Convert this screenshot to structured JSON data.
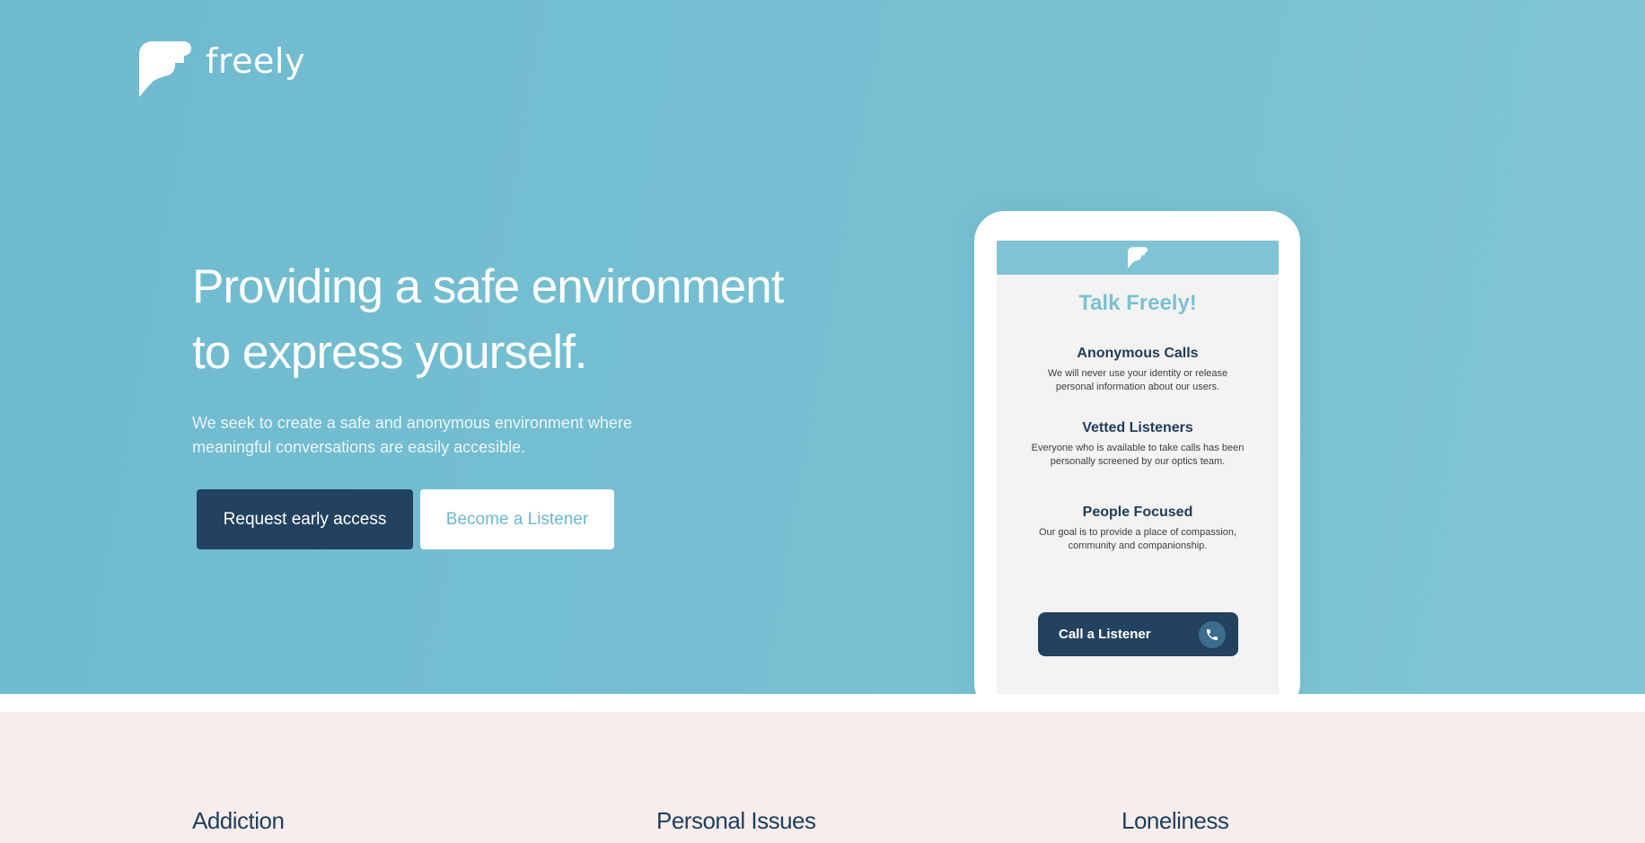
{
  "brand": {
    "name": "freely"
  },
  "hero": {
    "headline_line1": "Providing a safe environment",
    "headline_line2": "to express yourself.",
    "subtext_line1": "We seek to create a safe and anonymous environment where",
    "subtext_line2": "meaningful conversations are easily accesible.",
    "primary_button": "Request early access",
    "secondary_button": "Become a Listener"
  },
  "phone": {
    "title": "Talk Freely!",
    "features": [
      {
        "title": "Anonymous Calls",
        "desc_line1": "We will never use your identity or release",
        "desc_line2": "personal information about our users."
      },
      {
        "title": "Vetted Listeners",
        "desc_line1": "Everyone who is available to take calls has been",
        "desc_line2": "personally screened by our optics team."
      },
      {
        "title": "People Focused",
        "desc_line1": "Our goal is to provide a place of compassion,",
        "desc_line2": "community and companionship."
      }
    ],
    "call_button": "Call a Listener"
  },
  "categories": [
    "Addiction",
    "Personal Issues",
    "Loneliness"
  ],
  "colors": {
    "hero_bg": "#77c0d2",
    "navy": "#22425f",
    "accent": "#7cc1d3",
    "section_bg": "#f7eded"
  },
  "icons": {
    "logo": "freely-logo-icon",
    "phone": "phone-icon"
  }
}
